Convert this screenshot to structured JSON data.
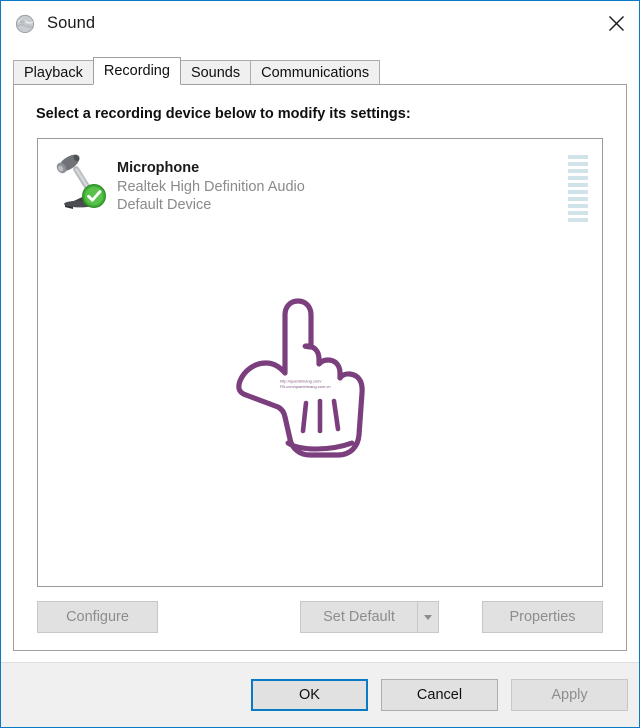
{
  "window": {
    "title": "Sound",
    "icon": "sound-speaker-icon",
    "close_label": "✕",
    "border_color": "#0a7ac4"
  },
  "tabs": [
    {
      "label": "Playback",
      "active": false
    },
    {
      "label": "Recording",
      "active": true
    },
    {
      "label": "Sounds",
      "active": false
    },
    {
      "label": "Communications",
      "active": false
    }
  ],
  "main": {
    "instruction": "Select a recording device below to modify its settings:"
  },
  "devices": [
    {
      "name": "Microphone",
      "driver": "Realtek High Definition Audio",
      "status": "Default Device",
      "icon": "microphone-icon",
      "badge": "default-device-check-badge",
      "level_segments": 10,
      "level_color": "#cfe3e9"
    }
  ],
  "device_buttons": {
    "configure": {
      "label": "Configure",
      "accel": "C",
      "enabled": false
    },
    "set_default": {
      "label": "Set Default",
      "accel": "S",
      "enabled": false
    },
    "set_default_dropdown": {
      "icon": "chevron-down-icon",
      "enabled": false
    },
    "properties": {
      "label": "Properties",
      "accel": "P",
      "enabled": false
    }
  },
  "footer_buttons": {
    "ok": {
      "label": "OK",
      "enabled": true,
      "default": true
    },
    "cancel": {
      "label": "Cancel",
      "enabled": true,
      "default": false
    },
    "apply": {
      "label": "Apply",
      "accel": "A",
      "enabled": false,
      "default": false
    }
  },
  "annotation": {
    "type": "hand-pointer-drawing",
    "color": "#7b3f7e",
    "watermark_line1": "http://quantrimang.com/",
    "watermark_line2": "FB.com/quantrimang.com.vn"
  }
}
